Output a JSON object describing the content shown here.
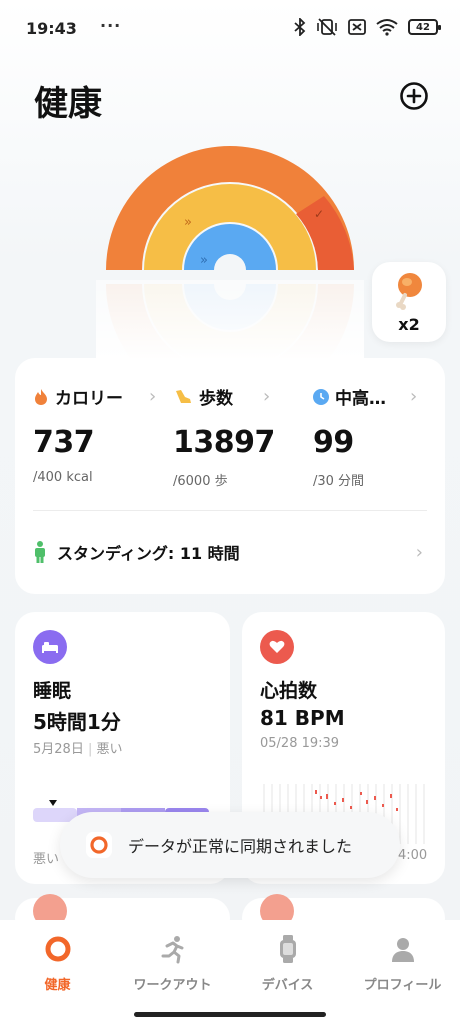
{
  "status_bar": {
    "time": "19:43",
    "dots": "···",
    "battery": "42"
  },
  "page": {
    "title": "健康"
  },
  "medal": {
    "count": "x2"
  },
  "activity": {
    "calories": {
      "label": "カロリー",
      "value": "737",
      "goal": "/400 kcal"
    },
    "steps": {
      "label": "歩数",
      "value": "13897",
      "goal": "/6000 歩"
    },
    "intensity": {
      "label": "中高…",
      "value": "99",
      "goal": "/30 分間"
    },
    "standing": {
      "label": "スタンディング: 11 時間"
    }
  },
  "sleep": {
    "title": "睡眠",
    "value": "5時間1分",
    "date": "5月28日",
    "quality": "悪い",
    "bottom_label": "悪い"
  },
  "heart": {
    "title": "心拍数",
    "value": "81 BPM",
    "time": "05/28 19:39",
    "axis_label": "4:00"
  },
  "toast": {
    "message": "データが正常に同期されました"
  },
  "nav": {
    "health": "健康",
    "workout": "ワークアウト",
    "devices": "デバイス",
    "profile": "プロフィール"
  },
  "colors": {
    "accent": "#f2672a",
    "calorie_ring": "#f0813a",
    "step_ring": "#f6be46",
    "intensity_ring": "#5aa9f2",
    "sleep": "#8a6cf0",
    "heart": "#ec5a4e"
  }
}
